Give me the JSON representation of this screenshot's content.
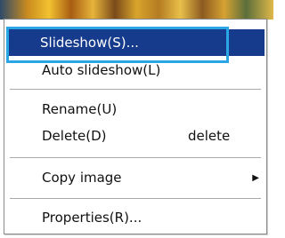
{
  "context_menu": {
    "items": [
      {
        "label": "Slideshow(S)...",
        "shortcut": "",
        "selected": true
      },
      {
        "label": "Auto slideshow(L)",
        "shortcut": ""
      },
      {
        "label": "Rename(U)",
        "shortcut": ""
      },
      {
        "label": "Delete(D)",
        "shortcut": "delete"
      },
      {
        "label": "Copy image",
        "shortcut": "",
        "has_submenu": true
      },
      {
        "label": "Properties(R)...",
        "shortcut": ""
      }
    ],
    "submenu_arrow_icon": "▶"
  },
  "colors": {
    "selection_background": "#173b8c",
    "annotation_outline": "#2aa6e4"
  }
}
